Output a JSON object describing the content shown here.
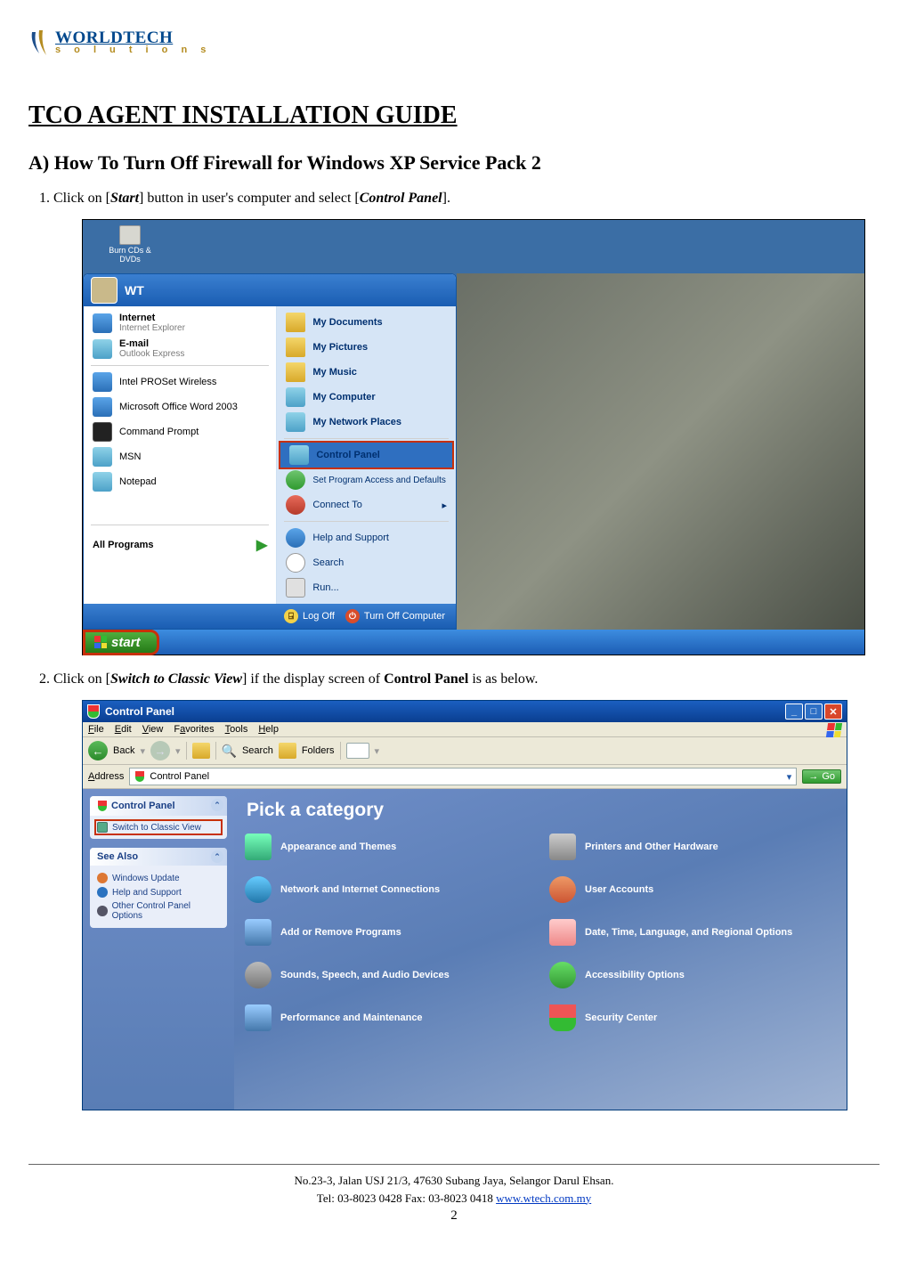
{
  "logo": {
    "company": "WORLDTECH",
    "sub_prefix": "s o l u t i o n s"
  },
  "title": "TCO AGENT INSTALLATION GUIDE",
  "sectionA": "A) How To Turn Off Firewall for Windows XP Service Pack 2",
  "steps": {
    "s1_pre": "Click on [",
    "s1_b1": "Start",
    "s1_mid": "] button in user's computer and select [",
    "s1_b2": "Control Panel",
    "s1_post": "].",
    "s2_pre": "Click on [",
    "s2_b1": "Switch to Classic View",
    "s2_mid": "] if the display screen of ",
    "s2_b2": "Control Panel",
    "s2_post": " is as below."
  },
  "startmenu": {
    "desktop_icon": "Burn CDs & DVDs",
    "user": "WT",
    "left": {
      "internet_t": "Internet",
      "internet_s": "Internet Explorer",
      "email_t": "E-mail",
      "email_s": "Outlook Express",
      "proset": "Intel PROSet Wireless",
      "word": "Microsoft Office Word 2003",
      "cmd": "Command Prompt",
      "msn": "MSN",
      "notepad": "Notepad",
      "allprog": "All Programs"
    },
    "right": {
      "docs": "My Documents",
      "pics": "My Pictures",
      "music": "My Music",
      "comp": "My Computer",
      "net": "My Network Places",
      "cpanel": "Control Panel",
      "defaults": "Set Program Access and Defaults",
      "connect": "Connect To",
      "help": "Help and Support",
      "search": "Search",
      "run": "Run..."
    },
    "footer": {
      "logoff": "Log Off",
      "turnoff": "Turn Off Computer"
    },
    "startbtn": "start"
  },
  "cpanel": {
    "title": "Control Panel",
    "menu": {
      "file": "File",
      "edit": "Edit",
      "view": "View",
      "fav": "Favorites",
      "tools": "Tools",
      "help": "Help"
    },
    "toolbar": {
      "back": "Back",
      "search": "Search",
      "folders": "Folders"
    },
    "address_label": "Address",
    "address_value": "Control Panel",
    "go": "Go",
    "side": {
      "panel1_h": "Control Panel",
      "switch": "Switch to Classic View",
      "panel2_h": "See Also",
      "wu": "Windows Update",
      "hs": "Help and Support",
      "other": "Other Control Panel Options"
    },
    "pick": "Pick a category",
    "cats": {
      "c1": "Appearance and Themes",
      "c2": "Printers and Other Hardware",
      "c3": "Network and Internet Connections",
      "c4": "User Accounts",
      "c5": "Add or Remove Programs",
      "c6": "Date, Time, Language, and Regional Options",
      "c7": "Sounds, Speech, and Audio Devices",
      "c8": "Accessibility Options",
      "c9": "Performance and Maintenance",
      "c10": "Security Center"
    }
  },
  "footer": {
    "addr": "No.23-3, Jalan USJ 21/3, 47630 Subang Jaya, Selangor Darul Ehsan.",
    "tel": "Tel: 03-8023 0428    Fax: 03-8023 0418  ",
    "url": "www.wtech.com.my",
    "page": "2"
  }
}
